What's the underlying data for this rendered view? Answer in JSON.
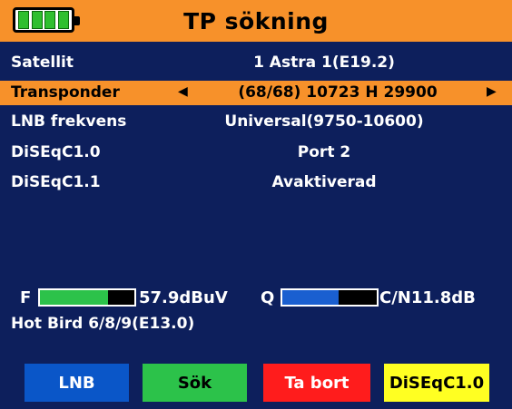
{
  "header": {
    "title": "TP sökning"
  },
  "rows": [
    {
      "label": "Satellit",
      "value": "1 Astra 1(E19.2)"
    },
    {
      "label": "Transponder",
      "value": "(68/68) 10723 H 29900"
    },
    {
      "label": "LNB frekvens",
      "value": "Universal(9750-10600)"
    },
    {
      "label": "DiSEqC1.0",
      "value": "Port 2"
    },
    {
      "label": "DiSEqC1.1",
      "value": "Avaktiverad"
    }
  ],
  "signal": {
    "f_label": "F",
    "f_value": "57.9dBuV",
    "f_level": 0.72,
    "q_label": "Q",
    "q_value": "C/N11.8dB",
    "q_level": 0.6
  },
  "satellite_name": "Hot Bird 6/8/9(E13.0)",
  "buttons": [
    {
      "label": "LNB",
      "color": "#0a56c8"
    },
    {
      "label": "Sök",
      "color": "#2cc24a"
    },
    {
      "label": "Ta bort",
      "color": "#ff1c1c"
    },
    {
      "label": "DiSEqC1.0",
      "color": "#ffff22"
    }
  ],
  "colors": {
    "accent": "#f7912a",
    "background": "#0d1f5c",
    "f_meter": "#2cc24a",
    "q_meter": "#1a5fd0"
  },
  "arrows": {
    "left": "◀",
    "right": "▶"
  }
}
